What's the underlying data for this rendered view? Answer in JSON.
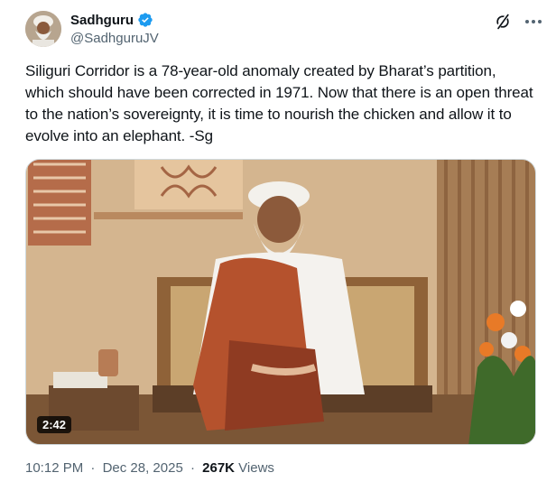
{
  "author": {
    "display_name": "Sadhguru",
    "handle": "@SadhguruJV",
    "verified": true,
    "verified_color": "#1d9bf0"
  },
  "tweet": {
    "text": "Siliguri Corridor is a 78-year-old anomaly created by Bharat’s partition, which should have been corrected in 1971. Now that there is an open threat to the nation’s sovereignty, it is time to nourish the chicken and allow it to evolve into an elephant. -Sg"
  },
  "media": {
    "type": "video",
    "duration": "2:42"
  },
  "meta": {
    "time": "10:12 PM",
    "separator": "·",
    "date": "Dec 28, 2025",
    "views_count": "267K",
    "views_label": "Views"
  },
  "icons": {
    "grok": "grok-icon",
    "more": "more-icon",
    "verified": "verified-badge-icon"
  },
  "colors": {
    "text_primary": "#0f1419",
    "text_secondary": "#536471",
    "border": "#cfd9de"
  }
}
